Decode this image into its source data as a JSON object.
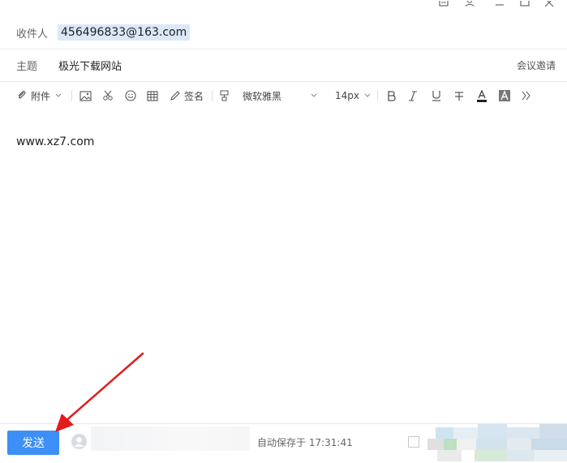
{
  "header": {
    "recipient_label": "收件人",
    "recipient_value": "456496833@163.com",
    "subject_label": "主题",
    "subject_value": "极光下载网站",
    "meeting_invite": "会议邀请"
  },
  "toolbar": {
    "attachment_label": "附件",
    "signature_label": "签名",
    "font_family": "微软雅黑",
    "font_size": "14px"
  },
  "editor": {
    "body_text": "www.xz7.com"
  },
  "footer": {
    "send_label": "发送",
    "autosave_text": "自动保存于 17:31:41"
  },
  "colors": {
    "accent": "#3d8ef7",
    "recipient_chip": "#dbe8f8",
    "annotation_arrow": "#e31b1b"
  }
}
